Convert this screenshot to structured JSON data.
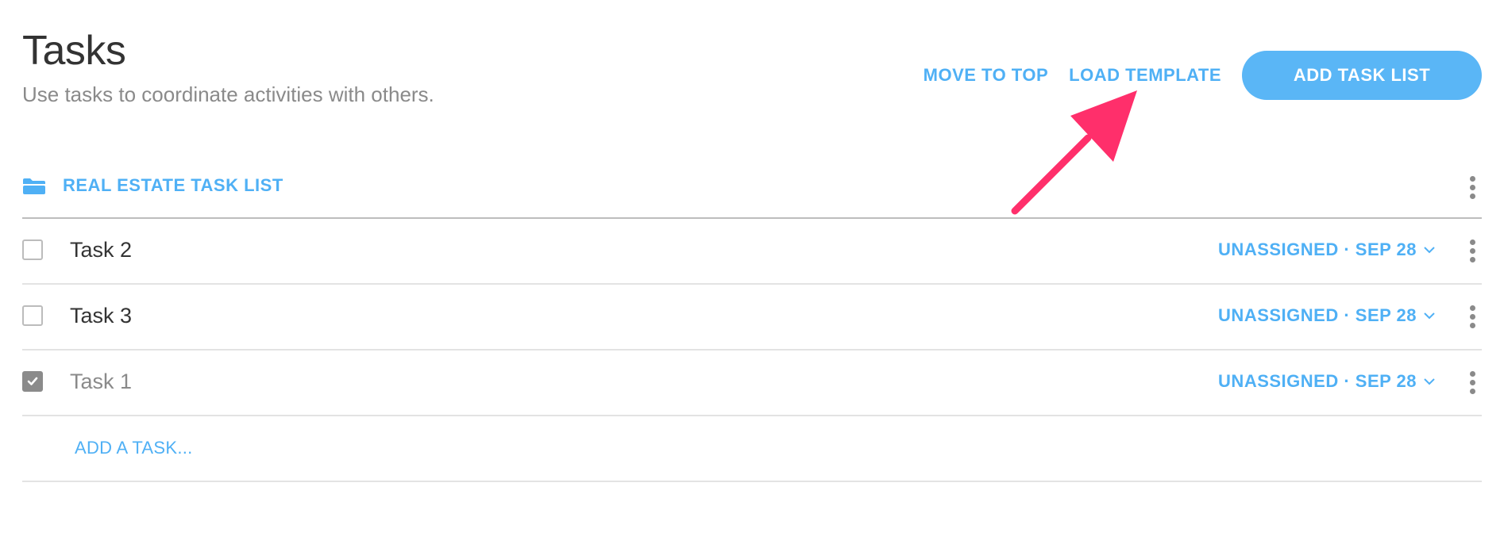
{
  "header": {
    "title": "Tasks",
    "subtitle": "Use tasks to coordinate activities with others."
  },
  "actions": {
    "move_to_top": "MOVE TO TOP",
    "load_template": "LOAD TEMPLATE",
    "add_task_list": "ADD TASK LIST"
  },
  "task_list": {
    "title": "REAL ESTATE TASK LIST",
    "icon": "folder-icon",
    "tasks": [
      {
        "name": "Task 2",
        "completed": false,
        "assignment": "UNASSIGNED · SEP 28"
      },
      {
        "name": "Task 3",
        "completed": false,
        "assignment": "UNASSIGNED · SEP 28"
      },
      {
        "name": "Task 1",
        "completed": true,
        "assignment": "UNASSIGNED · SEP 28"
      }
    ],
    "add_task_label": "ADD A TASK..."
  },
  "colors": {
    "accent": "#4fb0f5",
    "button": "#5ab6f6",
    "annotation_arrow": "#ff2f6b",
    "checked_box": "#8b8b8b"
  }
}
